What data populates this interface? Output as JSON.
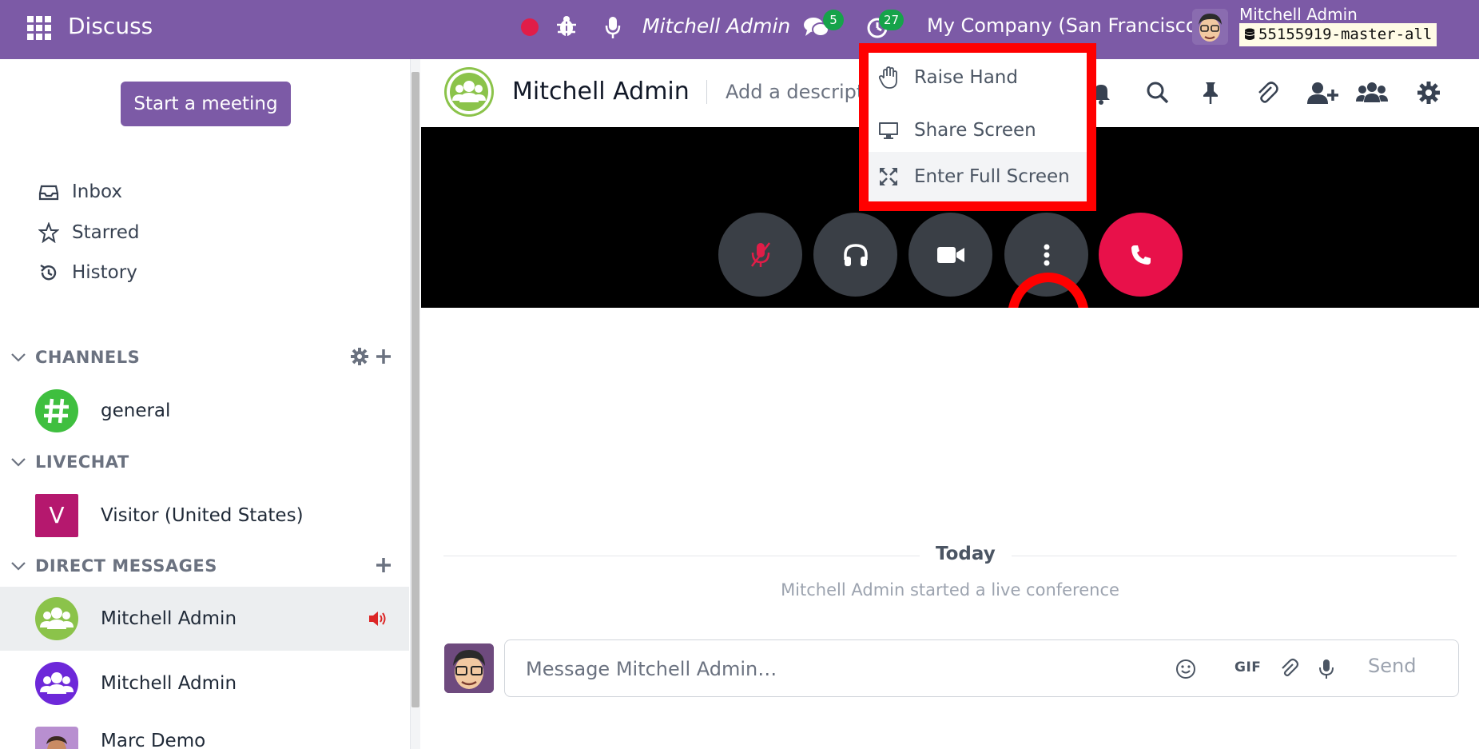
{
  "topbar": {
    "app_name": "Discuss",
    "user_label": "Mitchell Admin",
    "messages_count": "5",
    "activities_count": "27",
    "company": "My Company (San Francisco)",
    "user_name": "Mitchell Admin",
    "database": "55155919-master-all"
  },
  "sidebar": {
    "start_meeting": "Start a meeting",
    "nav": [
      {
        "label": "Inbox",
        "icon": "inbox-icon"
      },
      {
        "label": "Starred",
        "icon": "star-icon"
      },
      {
        "label": "History",
        "icon": "history-icon"
      }
    ],
    "sections": {
      "channels": "CHANNELS",
      "livechat": "LIVECHAT",
      "direct": "DIRECT MESSAGES"
    },
    "channels": [
      {
        "name": "general",
        "icon": "hashtag-icon",
        "color": "#3fbf3f"
      }
    ],
    "livechat": [
      {
        "name": "Visitor (United States)",
        "initial": "V",
        "color": "#b5186e"
      }
    ],
    "direct": [
      {
        "name": "Mitchell Admin",
        "color": "#8bc34a",
        "active": true,
        "speaking": true
      },
      {
        "name": "Mitchell Admin",
        "color": "#6d28d9"
      },
      {
        "name": "Marc Demo"
      }
    ]
  },
  "thread": {
    "name": "Mitchell Admin",
    "description_placeholder": "Add a description",
    "day": "Today",
    "notice": "Mitchell Admin started a live conference",
    "composer_placeholder": "Message Mitchell Admin…",
    "gif": "GIF",
    "send": "Send"
  },
  "call_menu": {
    "items": [
      {
        "label": "Raise Hand",
        "icon": "hand-icon"
      },
      {
        "label": "Share Screen",
        "icon": "monitor-icon"
      },
      {
        "label": "Enter Full Screen",
        "icon": "expand-icon"
      }
    ]
  },
  "colors": {
    "brand": "#7c5aa6",
    "hangup": "#e8114a",
    "highlight": "#ff0000",
    "badge": "#16a34a"
  }
}
